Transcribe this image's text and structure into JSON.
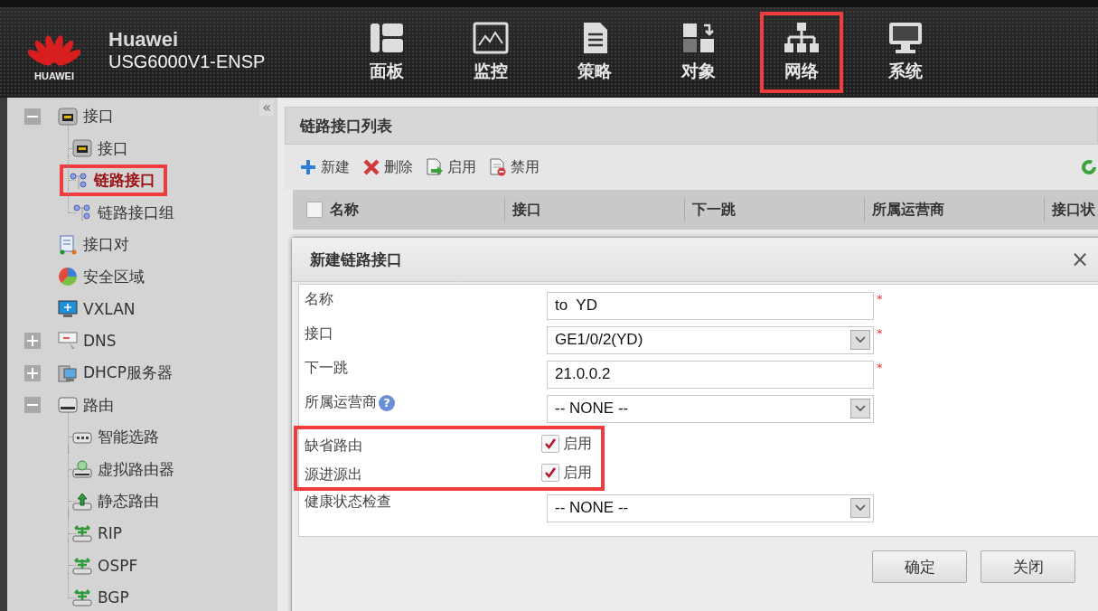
{
  "header": {
    "logo_text": "HUAWEI",
    "brand": "Huawei",
    "model": "USG6000V1-ENSP"
  },
  "nav": [
    {
      "label": "面板",
      "highlighted": false
    },
    {
      "label": "监控",
      "highlighted": false
    },
    {
      "label": "策略",
      "highlighted": false
    },
    {
      "label": "对象",
      "highlighted": false
    },
    {
      "label": "网络",
      "highlighted": true
    },
    {
      "label": "系统",
      "highlighted": false
    }
  ],
  "sidebar": {
    "collapse_glyph": "«",
    "tree": [
      {
        "label": "接口",
        "selected": false,
        "highlighted": false,
        "expanded": true,
        "children": [
          {
            "label": "接口",
            "selected": false,
            "highlighted": false
          },
          {
            "label": "链路接口",
            "selected": true,
            "highlighted": true
          },
          {
            "label": "链路接口组",
            "selected": false,
            "highlighted": false
          }
        ]
      },
      {
        "label": "接口对",
        "selected": false,
        "highlighted": false
      },
      {
        "label": "安全区域",
        "selected": false,
        "highlighted": false
      },
      {
        "label": "VXLAN",
        "selected": false,
        "highlighted": false
      },
      {
        "label": "DNS",
        "selected": false,
        "highlighted": false,
        "expanded": false
      },
      {
        "label": "DHCP服务器",
        "selected": false,
        "highlighted": false,
        "expanded": false
      },
      {
        "label": "路由",
        "selected": false,
        "highlighted": false,
        "expanded": true,
        "children": [
          {
            "label": "智能选路",
            "selected": false,
            "highlighted": false
          },
          {
            "label": "虚拟路由器",
            "selected": false,
            "highlighted": false
          },
          {
            "label": "静态路由",
            "selected": false,
            "highlighted": false
          },
          {
            "label": "RIP",
            "selected": false,
            "highlighted": false
          },
          {
            "label": "OSPF",
            "selected": false,
            "highlighted": false
          },
          {
            "label": "BGP",
            "selected": false,
            "highlighted": false
          }
        ]
      }
    ]
  },
  "panel": {
    "title": "链路接口列表",
    "toolbar": [
      {
        "kind": "add",
        "label": "新建"
      },
      {
        "kind": "delete",
        "label": "删除"
      },
      {
        "kind": "enable",
        "label": "启用"
      },
      {
        "kind": "disable",
        "label": "禁用"
      }
    ],
    "table": {
      "select_all_checked": false,
      "columns": [
        "名称",
        "接口",
        "下一跳",
        "所属运营商",
        "接口状"
      ]
    }
  },
  "dialog": {
    "title": "新建链路接口",
    "close_glyph": "×",
    "sections": [
      {
        "highlighted": false,
        "fields": [
          {
            "kind": "text",
            "label": "名称",
            "value": "to  YD",
            "required_mark": "*"
          },
          {
            "kind": "select",
            "label": "接口",
            "value": "GE1/0/2(YD)",
            "required_mark": "*"
          },
          {
            "kind": "text",
            "label": "下一跳",
            "value": "21.0.0.2",
            "required_mark": "*"
          },
          {
            "kind": "select",
            "label": "所属运营商",
            "help": "?",
            "value": "-- NONE --"
          }
        ]
      },
      {
        "highlighted": true,
        "fields": [
          {
            "kind": "checkbox",
            "label": "缺省路由",
            "checked": true,
            "option_label": "启用"
          },
          {
            "kind": "checkbox",
            "label": "源进源出",
            "checked": true,
            "option_label": "启用"
          }
        ]
      },
      {
        "highlighted": false,
        "fields": [
          {
            "kind": "select",
            "label": "健康状态检查",
            "value": "-- NONE --"
          }
        ]
      }
    ],
    "buttons": [
      "确定",
      "关闭"
    ]
  }
}
